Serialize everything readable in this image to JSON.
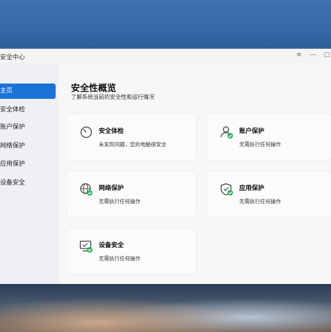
{
  "window": {
    "app_title": "安全中心",
    "controls": [
      "≡",
      "—",
      "□"
    ]
  },
  "sidebar": {
    "items": [
      {
        "label": "主页",
        "active": true
      },
      {
        "label": "安全体检",
        "active": false
      },
      {
        "label": "账户保护",
        "active": false
      },
      {
        "label": "网络保护",
        "active": false
      },
      {
        "label": "应用保护",
        "active": false
      },
      {
        "label": "设备安全",
        "active": false
      }
    ]
  },
  "main": {
    "title": "安全性概览",
    "subtitle": "了解系统当前的安全性和运行情况",
    "cards": [
      {
        "title": "安全体检",
        "desc": "未发现问题，您的电脑很安全",
        "icon": "scan-gauge-icon"
      },
      {
        "title": "账户保护",
        "desc": "无需执行任何操作",
        "icon": "user-check-icon"
      },
      {
        "title": "网络保护",
        "desc": "无需执行任何操作",
        "icon": "globe-check-icon"
      },
      {
        "title": "应用保护",
        "desc": "无需执行任何操作",
        "icon": "shield-check-icon"
      },
      {
        "title": "设备安全",
        "desc": "无需执行任何操作",
        "icon": "monitor-check-icon"
      }
    ]
  },
  "colors": {
    "accent": "#1a73d8",
    "ok_green": "#2fb55c"
  }
}
